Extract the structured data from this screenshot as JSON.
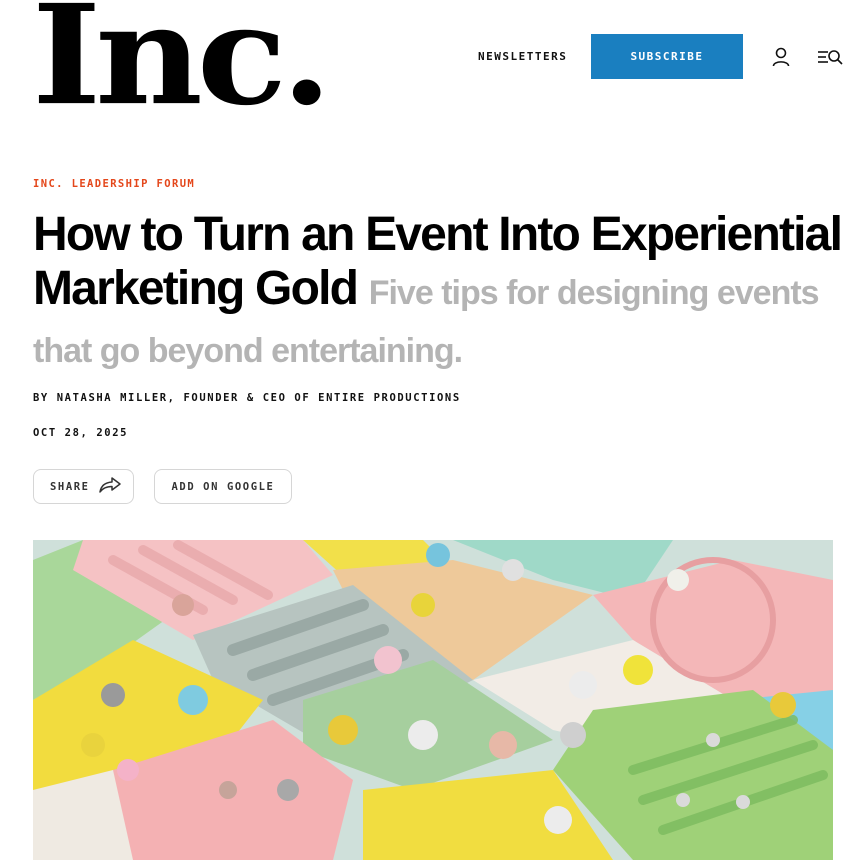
{
  "header": {
    "logo_text": "Inc.",
    "newsletters_label": "NEWSLETTERS",
    "subscribe_label": "SUBSCRIBE",
    "user_icon": "user-icon",
    "menu_icon": "menu-search-icon",
    "accent_color": "#1a7fc0"
  },
  "article": {
    "kicker": "INC. LEADERSHIP FORUM",
    "kicker_color": "#e4471b",
    "title": "How to Turn an Event Into Experiential Marketing Gold",
    "dek": "Five tips for designing events that go beyond entertaining.",
    "byline": "BY NATASHA MILLER, FOUNDER & CEO OF ENTIRE PRODUCTIONS",
    "date": "OCT 28, 2025",
    "share_label": "SHARE",
    "share_icon": "share-arrow-icon",
    "google_label": "ADD ON GOOGLE"
  },
  "hero_image": {
    "description_icon": "pastel-tiles-illustration"
  }
}
